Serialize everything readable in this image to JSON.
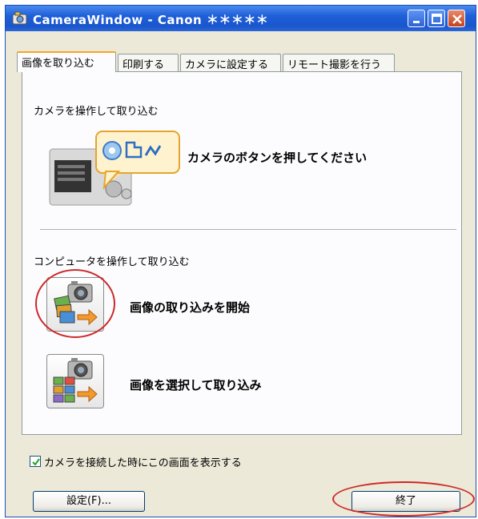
{
  "window": {
    "title": "CameraWindow - Canon ＊＊＊＊＊",
    "app_icon": "camerawindow-app-icon",
    "buttons": {
      "minimize": "minimize-icon",
      "maximize": "maximize-icon",
      "close": "close-icon"
    }
  },
  "tabs": [
    {
      "label": "画像を取り込む",
      "active": true
    },
    {
      "label": "印刷する",
      "active": false
    },
    {
      "label": "カメラに設定する",
      "active": false
    },
    {
      "label": "リモート撮影を行う",
      "active": false
    }
  ],
  "panel": {
    "camera_section": {
      "label": "カメラを操作して取り込む",
      "instruction": "カメラのボタンを押してください"
    },
    "computer_section": {
      "label": "コンピュータを操作して取り込む",
      "actions": [
        {
          "label": "画像の取り込みを開始",
          "icon": "import-all-images-icon",
          "highlighted": true
        },
        {
          "label": "画像を選択して取り込み",
          "icon": "select-import-images-icon",
          "highlighted": false
        }
      ]
    }
  },
  "footer": {
    "checkbox": {
      "label": "カメラを接続した時にこの画面を表示する",
      "checked": true
    },
    "settings_button": "設定(F)...",
    "finish_button": "終了"
  },
  "colors": {
    "titlebar": "#1f5fd8",
    "highlight_ring": "#cc2a2a",
    "tab_accent": "#f5a623"
  }
}
